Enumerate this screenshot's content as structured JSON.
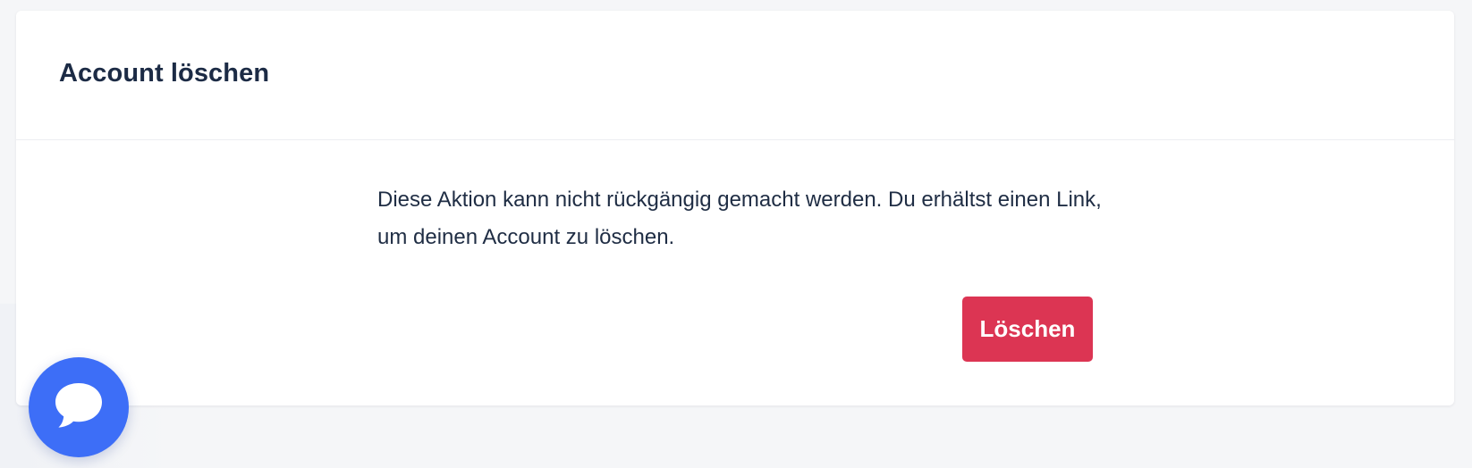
{
  "page": {
    "background_color": "#f5f6f8"
  },
  "card": {
    "title": "Account löschen",
    "description": "Diese Aktion kann nicht rückgängig gemacht werden. Du erhältst einen Link, um deinen Account zu löschen.",
    "delete_button_label": "Löschen",
    "delete_button_color": "#dc3553"
  },
  "chat_widget": {
    "icon": "chat-bubble-icon",
    "color": "#3d6ef7"
  }
}
